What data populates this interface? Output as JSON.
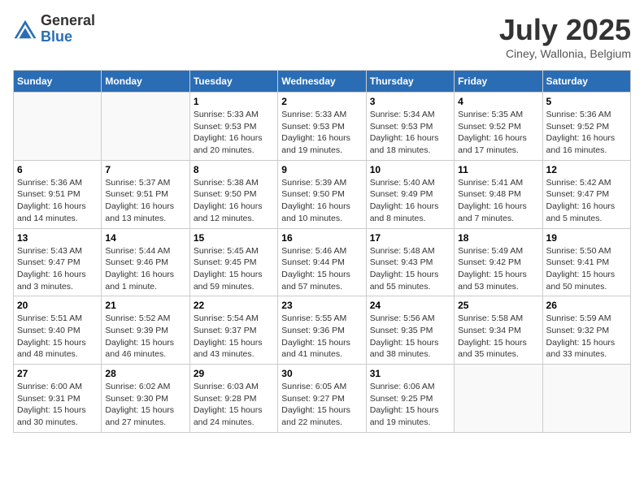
{
  "header": {
    "logo_general": "General",
    "logo_blue": "Blue",
    "month_year": "July 2025",
    "location": "Ciney, Wallonia, Belgium"
  },
  "days_of_week": [
    "Sunday",
    "Monday",
    "Tuesday",
    "Wednesday",
    "Thursday",
    "Friday",
    "Saturday"
  ],
  "weeks": [
    [
      {
        "day": "",
        "info": ""
      },
      {
        "day": "",
        "info": ""
      },
      {
        "day": "1",
        "info": "Sunrise: 5:33 AM\nSunset: 9:53 PM\nDaylight: 16 hours and 20 minutes."
      },
      {
        "day": "2",
        "info": "Sunrise: 5:33 AM\nSunset: 9:53 PM\nDaylight: 16 hours and 19 minutes."
      },
      {
        "day": "3",
        "info": "Sunrise: 5:34 AM\nSunset: 9:53 PM\nDaylight: 16 hours and 18 minutes."
      },
      {
        "day": "4",
        "info": "Sunrise: 5:35 AM\nSunset: 9:52 PM\nDaylight: 16 hours and 17 minutes."
      },
      {
        "day": "5",
        "info": "Sunrise: 5:36 AM\nSunset: 9:52 PM\nDaylight: 16 hours and 16 minutes."
      }
    ],
    [
      {
        "day": "6",
        "info": "Sunrise: 5:36 AM\nSunset: 9:51 PM\nDaylight: 16 hours and 14 minutes."
      },
      {
        "day": "7",
        "info": "Sunrise: 5:37 AM\nSunset: 9:51 PM\nDaylight: 16 hours and 13 minutes."
      },
      {
        "day": "8",
        "info": "Sunrise: 5:38 AM\nSunset: 9:50 PM\nDaylight: 16 hours and 12 minutes."
      },
      {
        "day": "9",
        "info": "Sunrise: 5:39 AM\nSunset: 9:50 PM\nDaylight: 16 hours and 10 minutes."
      },
      {
        "day": "10",
        "info": "Sunrise: 5:40 AM\nSunset: 9:49 PM\nDaylight: 16 hours and 8 minutes."
      },
      {
        "day": "11",
        "info": "Sunrise: 5:41 AM\nSunset: 9:48 PM\nDaylight: 16 hours and 7 minutes."
      },
      {
        "day": "12",
        "info": "Sunrise: 5:42 AM\nSunset: 9:47 PM\nDaylight: 16 hours and 5 minutes."
      }
    ],
    [
      {
        "day": "13",
        "info": "Sunrise: 5:43 AM\nSunset: 9:47 PM\nDaylight: 16 hours and 3 minutes."
      },
      {
        "day": "14",
        "info": "Sunrise: 5:44 AM\nSunset: 9:46 PM\nDaylight: 16 hours and 1 minute."
      },
      {
        "day": "15",
        "info": "Sunrise: 5:45 AM\nSunset: 9:45 PM\nDaylight: 15 hours and 59 minutes."
      },
      {
        "day": "16",
        "info": "Sunrise: 5:46 AM\nSunset: 9:44 PM\nDaylight: 15 hours and 57 minutes."
      },
      {
        "day": "17",
        "info": "Sunrise: 5:48 AM\nSunset: 9:43 PM\nDaylight: 15 hours and 55 minutes."
      },
      {
        "day": "18",
        "info": "Sunrise: 5:49 AM\nSunset: 9:42 PM\nDaylight: 15 hours and 53 minutes."
      },
      {
        "day": "19",
        "info": "Sunrise: 5:50 AM\nSunset: 9:41 PM\nDaylight: 15 hours and 50 minutes."
      }
    ],
    [
      {
        "day": "20",
        "info": "Sunrise: 5:51 AM\nSunset: 9:40 PM\nDaylight: 15 hours and 48 minutes."
      },
      {
        "day": "21",
        "info": "Sunrise: 5:52 AM\nSunset: 9:39 PM\nDaylight: 15 hours and 46 minutes."
      },
      {
        "day": "22",
        "info": "Sunrise: 5:54 AM\nSunset: 9:37 PM\nDaylight: 15 hours and 43 minutes."
      },
      {
        "day": "23",
        "info": "Sunrise: 5:55 AM\nSunset: 9:36 PM\nDaylight: 15 hours and 41 minutes."
      },
      {
        "day": "24",
        "info": "Sunrise: 5:56 AM\nSunset: 9:35 PM\nDaylight: 15 hours and 38 minutes."
      },
      {
        "day": "25",
        "info": "Sunrise: 5:58 AM\nSunset: 9:34 PM\nDaylight: 15 hours and 35 minutes."
      },
      {
        "day": "26",
        "info": "Sunrise: 5:59 AM\nSunset: 9:32 PM\nDaylight: 15 hours and 33 minutes."
      }
    ],
    [
      {
        "day": "27",
        "info": "Sunrise: 6:00 AM\nSunset: 9:31 PM\nDaylight: 15 hours and 30 minutes."
      },
      {
        "day": "28",
        "info": "Sunrise: 6:02 AM\nSunset: 9:30 PM\nDaylight: 15 hours and 27 minutes."
      },
      {
        "day": "29",
        "info": "Sunrise: 6:03 AM\nSunset: 9:28 PM\nDaylight: 15 hours and 24 minutes."
      },
      {
        "day": "30",
        "info": "Sunrise: 6:05 AM\nSunset: 9:27 PM\nDaylight: 15 hours and 22 minutes."
      },
      {
        "day": "31",
        "info": "Sunrise: 6:06 AM\nSunset: 9:25 PM\nDaylight: 15 hours and 19 minutes."
      },
      {
        "day": "",
        "info": ""
      },
      {
        "day": "",
        "info": ""
      }
    ]
  ]
}
